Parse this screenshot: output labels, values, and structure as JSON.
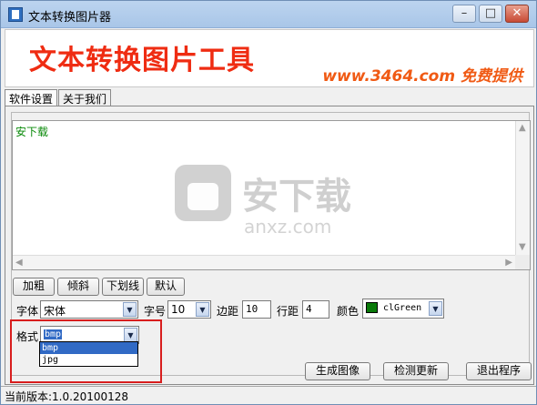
{
  "window": {
    "title": "文本转换图片器"
  },
  "window_controls": {
    "minimize": "–",
    "maximize": "□",
    "close": "✕"
  },
  "banner": {
    "main": "文本转换图片工具",
    "sub": "www.3464.com 免费提供"
  },
  "tabs": [
    {
      "label": "软件设置",
      "active": true
    },
    {
      "label": "关于我们",
      "active": false
    }
  ],
  "editor": {
    "text": "安下载"
  },
  "watermark": {
    "big": "安下载",
    "small": "anxz.com"
  },
  "format_buttons": {
    "bold": "加粗",
    "italic": "倾斜",
    "underline": "下划线",
    "default": "默认"
  },
  "font": {
    "label": "字体",
    "value": "宋体"
  },
  "size": {
    "label": "字号",
    "value": "10"
  },
  "margin": {
    "label": "边距",
    "value": "10"
  },
  "line_spacing": {
    "label": "行距",
    "value": "4"
  },
  "color": {
    "label": "颜色",
    "value": "clGreen",
    "hex": "#0a7a0a"
  },
  "format": {
    "label": "格式",
    "value": "bmp",
    "options": [
      "bmp",
      "jpg"
    ]
  },
  "actions": {
    "generate": "生成图像",
    "update": "检测更新",
    "exit": "退出程序"
  },
  "status": {
    "version": "当前版本:1.0.20100128"
  },
  "colors": {
    "accent_red": "#d81e1e",
    "banner_red": "#ef2c12",
    "selection_blue": "#316ac5"
  },
  "icons": [
    "app-icon",
    "chevron-down-icon",
    "scroll-up-arrow-icon",
    "scroll-down-arrow-icon",
    "scroll-left-arrow-icon",
    "scroll-right-arrow-icon"
  ]
}
